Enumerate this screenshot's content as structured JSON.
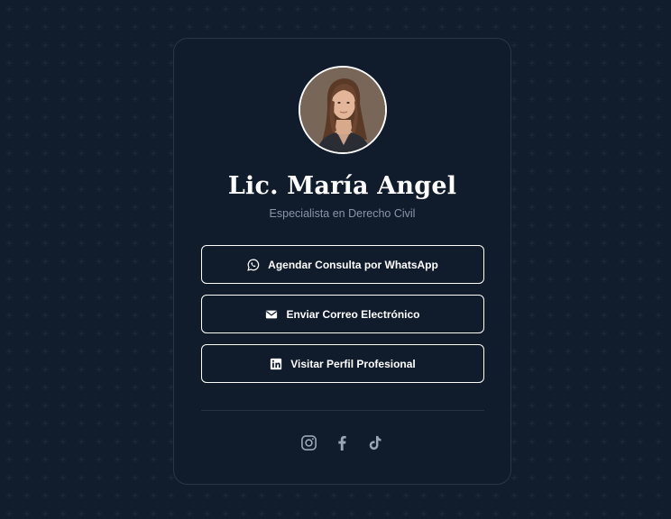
{
  "profile": {
    "name": "Lic. María Angel",
    "title": "Especialista en Derecho Civil"
  },
  "buttons": [
    {
      "label": "Agendar Consulta por WhatsApp",
      "icon": "whatsapp-icon"
    },
    {
      "label": "Enviar Correo Electrónico",
      "icon": "envelope-icon"
    },
    {
      "label": "Visitar Perfil Profesional",
      "icon": "linkedin-icon"
    }
  ],
  "social": [
    {
      "icon": "instagram-icon"
    },
    {
      "icon": "facebook-icon"
    },
    {
      "icon": "tiktok-icon"
    }
  ],
  "colors": {
    "background": "#111c2d",
    "card": "#101b2c",
    "text": "#ffffff",
    "muted": "#8a96a8",
    "social_icon": "#9aa5b5"
  }
}
